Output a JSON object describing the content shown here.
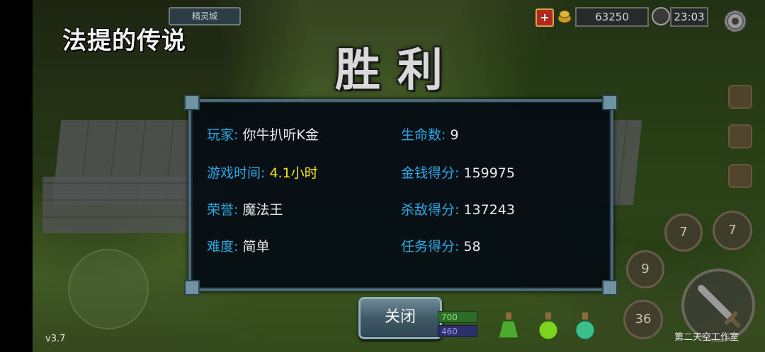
{
  "game": {
    "title": "法提的传说",
    "version": "v3.7",
    "studio": "第二天空工作室"
  },
  "hud": {
    "map_name": "精灵城",
    "gold": "63250",
    "time": "23:03",
    "plus_label": "+"
  },
  "victory": {
    "title": "胜利"
  },
  "stats": {
    "player_label": "玩家:",
    "player_value": "你牛扒听K金",
    "playtime_label": "游戏时间:",
    "playtime_value": "4.1小时",
    "honor_label": "荣誉:",
    "honor_value": "魔法王",
    "difficulty_label": "难度:",
    "difficulty_value": "简单",
    "lives_label": "生命数:",
    "lives_value": "9",
    "gold_score_label": "金钱得分:",
    "gold_score_value": "159975",
    "kill_score_label": "杀敌得分:",
    "kill_score_value": "137243",
    "quest_score_label": "任务得分:",
    "quest_score_value": "58"
  },
  "close_button": {
    "label": "关闭"
  },
  "bars": {
    "hp": "700",
    "mp": "460"
  },
  "skills": {
    "s1": "7",
    "s2": "7",
    "s3": "9",
    "s4": "36"
  },
  "colors": {
    "stat_key": "#2aa9e4",
    "highlight": "#f3e41e",
    "panel_border": "#4b6a79"
  },
  "icons": [
    "plus-icon",
    "coin-icon",
    "clock-icon",
    "gear-icon",
    "potion-green-icon",
    "potion-lime-icon",
    "potion-teal-icon",
    "sword-icon",
    "help-icon",
    "bag-icon",
    "chest-icon"
  ]
}
